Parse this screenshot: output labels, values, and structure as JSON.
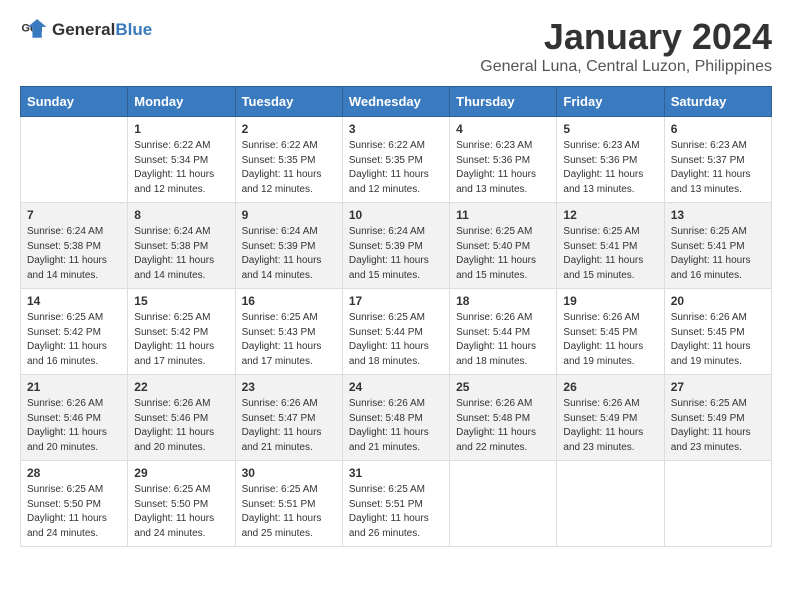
{
  "header": {
    "logo_general": "General",
    "logo_blue": "Blue",
    "main_title": "January 2024",
    "subtitle": "General Luna, Central Luzon, Philippines"
  },
  "calendar": {
    "days_of_week": [
      "Sunday",
      "Monday",
      "Tuesday",
      "Wednesday",
      "Thursday",
      "Friday",
      "Saturday"
    ],
    "weeks": [
      [
        {
          "num": "",
          "info": ""
        },
        {
          "num": "1",
          "info": "Sunrise: 6:22 AM\nSunset: 5:34 PM\nDaylight: 11 hours\nand 12 minutes."
        },
        {
          "num": "2",
          "info": "Sunrise: 6:22 AM\nSunset: 5:35 PM\nDaylight: 11 hours\nand 12 minutes."
        },
        {
          "num": "3",
          "info": "Sunrise: 6:22 AM\nSunset: 5:35 PM\nDaylight: 11 hours\nand 12 minutes."
        },
        {
          "num": "4",
          "info": "Sunrise: 6:23 AM\nSunset: 5:36 PM\nDaylight: 11 hours\nand 13 minutes."
        },
        {
          "num": "5",
          "info": "Sunrise: 6:23 AM\nSunset: 5:36 PM\nDaylight: 11 hours\nand 13 minutes."
        },
        {
          "num": "6",
          "info": "Sunrise: 6:23 AM\nSunset: 5:37 PM\nDaylight: 11 hours\nand 13 minutes."
        }
      ],
      [
        {
          "num": "7",
          "info": "Sunrise: 6:24 AM\nSunset: 5:38 PM\nDaylight: 11 hours\nand 14 minutes."
        },
        {
          "num": "8",
          "info": "Sunrise: 6:24 AM\nSunset: 5:38 PM\nDaylight: 11 hours\nand 14 minutes."
        },
        {
          "num": "9",
          "info": "Sunrise: 6:24 AM\nSunset: 5:39 PM\nDaylight: 11 hours\nand 14 minutes."
        },
        {
          "num": "10",
          "info": "Sunrise: 6:24 AM\nSunset: 5:39 PM\nDaylight: 11 hours\nand 15 minutes."
        },
        {
          "num": "11",
          "info": "Sunrise: 6:25 AM\nSunset: 5:40 PM\nDaylight: 11 hours\nand 15 minutes."
        },
        {
          "num": "12",
          "info": "Sunrise: 6:25 AM\nSunset: 5:41 PM\nDaylight: 11 hours\nand 15 minutes."
        },
        {
          "num": "13",
          "info": "Sunrise: 6:25 AM\nSunset: 5:41 PM\nDaylight: 11 hours\nand 16 minutes."
        }
      ],
      [
        {
          "num": "14",
          "info": "Sunrise: 6:25 AM\nSunset: 5:42 PM\nDaylight: 11 hours\nand 16 minutes."
        },
        {
          "num": "15",
          "info": "Sunrise: 6:25 AM\nSunset: 5:42 PM\nDaylight: 11 hours\nand 17 minutes."
        },
        {
          "num": "16",
          "info": "Sunrise: 6:25 AM\nSunset: 5:43 PM\nDaylight: 11 hours\nand 17 minutes."
        },
        {
          "num": "17",
          "info": "Sunrise: 6:25 AM\nSunset: 5:44 PM\nDaylight: 11 hours\nand 18 minutes."
        },
        {
          "num": "18",
          "info": "Sunrise: 6:26 AM\nSunset: 5:44 PM\nDaylight: 11 hours\nand 18 minutes."
        },
        {
          "num": "19",
          "info": "Sunrise: 6:26 AM\nSunset: 5:45 PM\nDaylight: 11 hours\nand 19 minutes."
        },
        {
          "num": "20",
          "info": "Sunrise: 6:26 AM\nSunset: 5:45 PM\nDaylight: 11 hours\nand 19 minutes."
        }
      ],
      [
        {
          "num": "21",
          "info": "Sunrise: 6:26 AM\nSunset: 5:46 PM\nDaylight: 11 hours\nand 20 minutes."
        },
        {
          "num": "22",
          "info": "Sunrise: 6:26 AM\nSunset: 5:46 PM\nDaylight: 11 hours\nand 20 minutes."
        },
        {
          "num": "23",
          "info": "Sunrise: 6:26 AM\nSunset: 5:47 PM\nDaylight: 11 hours\nand 21 minutes."
        },
        {
          "num": "24",
          "info": "Sunrise: 6:26 AM\nSunset: 5:48 PM\nDaylight: 11 hours\nand 21 minutes."
        },
        {
          "num": "25",
          "info": "Sunrise: 6:26 AM\nSunset: 5:48 PM\nDaylight: 11 hours\nand 22 minutes."
        },
        {
          "num": "26",
          "info": "Sunrise: 6:26 AM\nSunset: 5:49 PM\nDaylight: 11 hours\nand 23 minutes."
        },
        {
          "num": "27",
          "info": "Sunrise: 6:25 AM\nSunset: 5:49 PM\nDaylight: 11 hours\nand 23 minutes."
        }
      ],
      [
        {
          "num": "28",
          "info": "Sunrise: 6:25 AM\nSunset: 5:50 PM\nDaylight: 11 hours\nand 24 minutes."
        },
        {
          "num": "29",
          "info": "Sunrise: 6:25 AM\nSunset: 5:50 PM\nDaylight: 11 hours\nand 24 minutes."
        },
        {
          "num": "30",
          "info": "Sunrise: 6:25 AM\nSunset: 5:51 PM\nDaylight: 11 hours\nand 25 minutes."
        },
        {
          "num": "31",
          "info": "Sunrise: 6:25 AM\nSunset: 5:51 PM\nDaylight: 11 hours\nand 26 minutes."
        },
        {
          "num": "",
          "info": ""
        },
        {
          "num": "",
          "info": ""
        },
        {
          "num": "",
          "info": ""
        }
      ]
    ]
  }
}
